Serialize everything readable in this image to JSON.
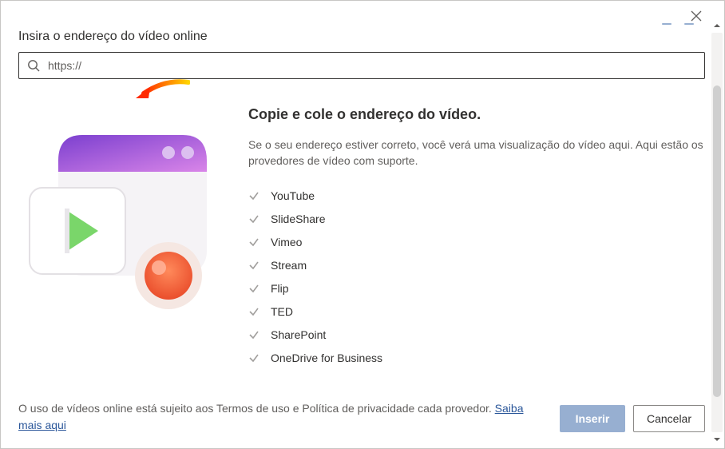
{
  "dialog": {
    "heading": "Insira o endereço do vídeo online",
    "search": {
      "placeholder": "https://",
      "value": ""
    },
    "info": {
      "title": "Copie e cole o endereço do vídeo.",
      "description": "Se o seu endereço estiver correto, você verá uma visualização do vídeo aqui. Aqui estão os provedores de vídeo com suporte."
    },
    "providers": [
      "YouTube",
      "SlideShare",
      "Vimeo",
      "Stream",
      "Flip",
      "TED",
      "SharePoint",
      "OneDrive for Business"
    ],
    "footer": {
      "disclaimer": "O uso de vídeos online está sujeito aos Termos de uso e Política de privacidade cada provedor.  ",
      "learn_more": "Saiba mais aqui"
    },
    "buttons": {
      "insert": "Inserir",
      "cancel": "Cancelar"
    }
  }
}
